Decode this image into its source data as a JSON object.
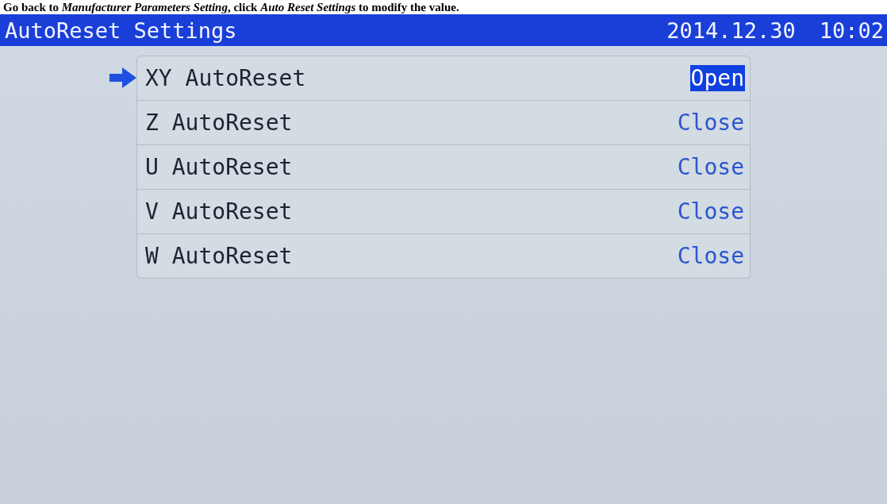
{
  "caption": "Go back to *Manufacturer Parameters Setting*, click *Auto Reset Settings* to modify the value.",
  "title_bar": {
    "title": "AutoReset Settings",
    "date": "2014.12.30",
    "time": "10:02"
  },
  "settings": [
    {
      "label": "XY AutoReset",
      "value": "Open",
      "selected": true
    },
    {
      "label": "Z AutoReset",
      "value": "Close",
      "selected": false
    },
    {
      "label": "U AutoReset",
      "value": "Close",
      "selected": false
    },
    {
      "label": "V AutoReset",
      "value": "Close",
      "selected": false
    },
    {
      "label": "W AutoReset",
      "value": "Close",
      "selected": false
    }
  ]
}
